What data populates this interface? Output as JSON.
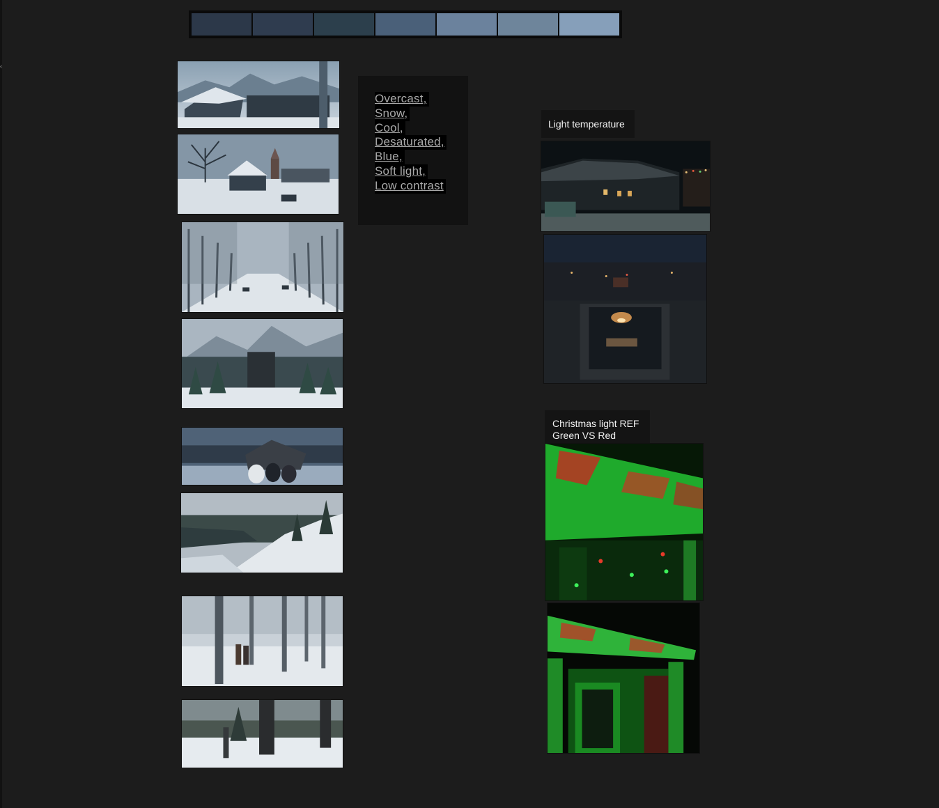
{
  "palette": {
    "swatches": [
      "#2c3849",
      "#2f3c4f",
      "#2c3f4c",
      "#4a6079",
      "#6b829d",
      "#6e859b",
      "#869fba"
    ]
  },
  "moodboard": {
    "keywords": [
      "Overcast,",
      "Snow,",
      "Cool,",
      "Desaturated,",
      "Blue,",
      "Soft light,",
      "Low contrast"
    ],
    "label_light_temperature": "Light temperature",
    "label_christmas_line1": "Christmas light REF",
    "label_christmas_line2": "Green VS Red"
  },
  "images": {
    "left_column": [
      "snowy-mountain-village-photo",
      "snowy-town-church-photo",
      "snowy-tree-lined-road-photo",
      "snowy-forest-bridge-photo",
      "snowy-barn-horses-photo",
      "snowy-hillside-river-photo",
      "snowy-park-couple-photo",
      "snowy-park-figure-photo"
    ],
    "right_column": [
      "night-house-street-photo",
      "night-town-window-photo",
      "green-red-christmas-lights-photo-1",
      "green-red-christmas-lights-photo-2"
    ]
  },
  "colors": {
    "background": "#1c1c1c",
    "note_background": "#121212",
    "keyword_text": "#a9a9a9",
    "label_text": "#f2f2f2"
  }
}
